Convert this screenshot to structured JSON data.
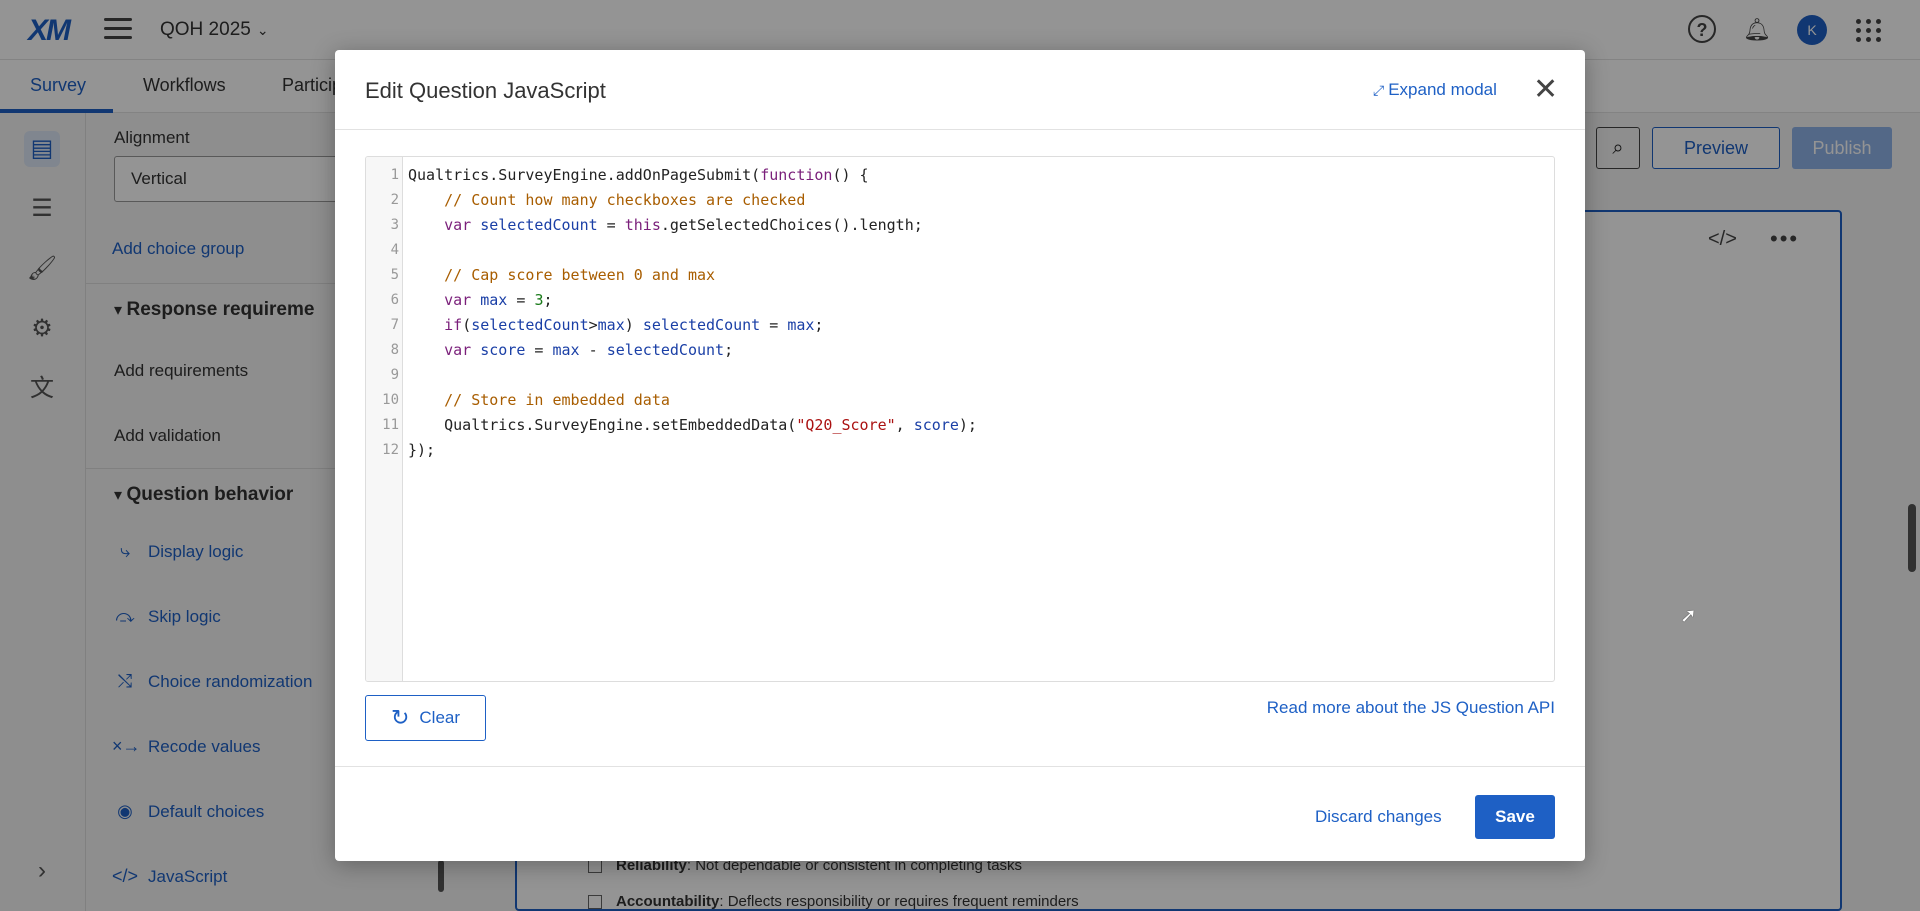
{
  "topbar": {
    "logo": "XM",
    "project_title": "QOH 2025",
    "avatar_initial": "K"
  },
  "tabs": [
    "Survey",
    "Workflows",
    "Particip"
  ],
  "panel": {
    "alignment_label": "Alignment",
    "alignment_value": "Vertical",
    "add_choice_group": "Add choice group",
    "response_requirements": "Response requireme",
    "add_requirements": "Add requirements",
    "add_validation": "Add validation",
    "question_behavior": "Question behavior",
    "behavior_items": [
      {
        "label": "Display logic",
        "icon": "display-logic-icon"
      },
      {
        "label": "Skip logic",
        "icon": "skip-logic-icon"
      },
      {
        "label": "Choice randomization",
        "icon": "shuffle-icon"
      },
      {
        "label": "Recode values",
        "icon": "recode-icon"
      },
      {
        "label": "Default choices",
        "icon": "radio-icon"
      },
      {
        "label": "JavaScript",
        "icon": "code-icon"
      }
    ]
  },
  "toolbar": {
    "preview": "Preview",
    "publish": "Publish"
  },
  "question_choices": [
    {
      "title": "Reliability",
      "text": ": Not dependable or consistent in completing tasks"
    },
    {
      "title": "Accountability",
      "text": ": Deflects responsibility or requires frequent reminders"
    }
  ],
  "modal": {
    "title": "Edit Question JavaScript",
    "expand": "Expand modal",
    "clear": "Clear",
    "api_link": "Read more about the JS Question API",
    "discard": "Discard changes",
    "save": "Save",
    "code_lines": [
      "Qualtrics.SurveyEngine.addOnPageSubmit(function() {",
      "    // Count how many checkboxes are checked",
      "    var selectedCount = this.getSelectedChoices().length;",
      "",
      "    // Cap score between 0 and max",
      "    var max = 3;",
      "    if(selectedCount>max) selectedCount = max;",
      "    var score = max - selectedCount;",
      "",
      "    // Store in embedded data",
      "    Qualtrics.SurveyEngine.setEmbeddedData(\"Q20_Score\", score);",
      "});"
    ]
  },
  "colors": {
    "accent": "#1e60c5",
    "publish_disabled": "#8fb3e8",
    "overlay": "rgba(0,0,0,0.42)"
  }
}
